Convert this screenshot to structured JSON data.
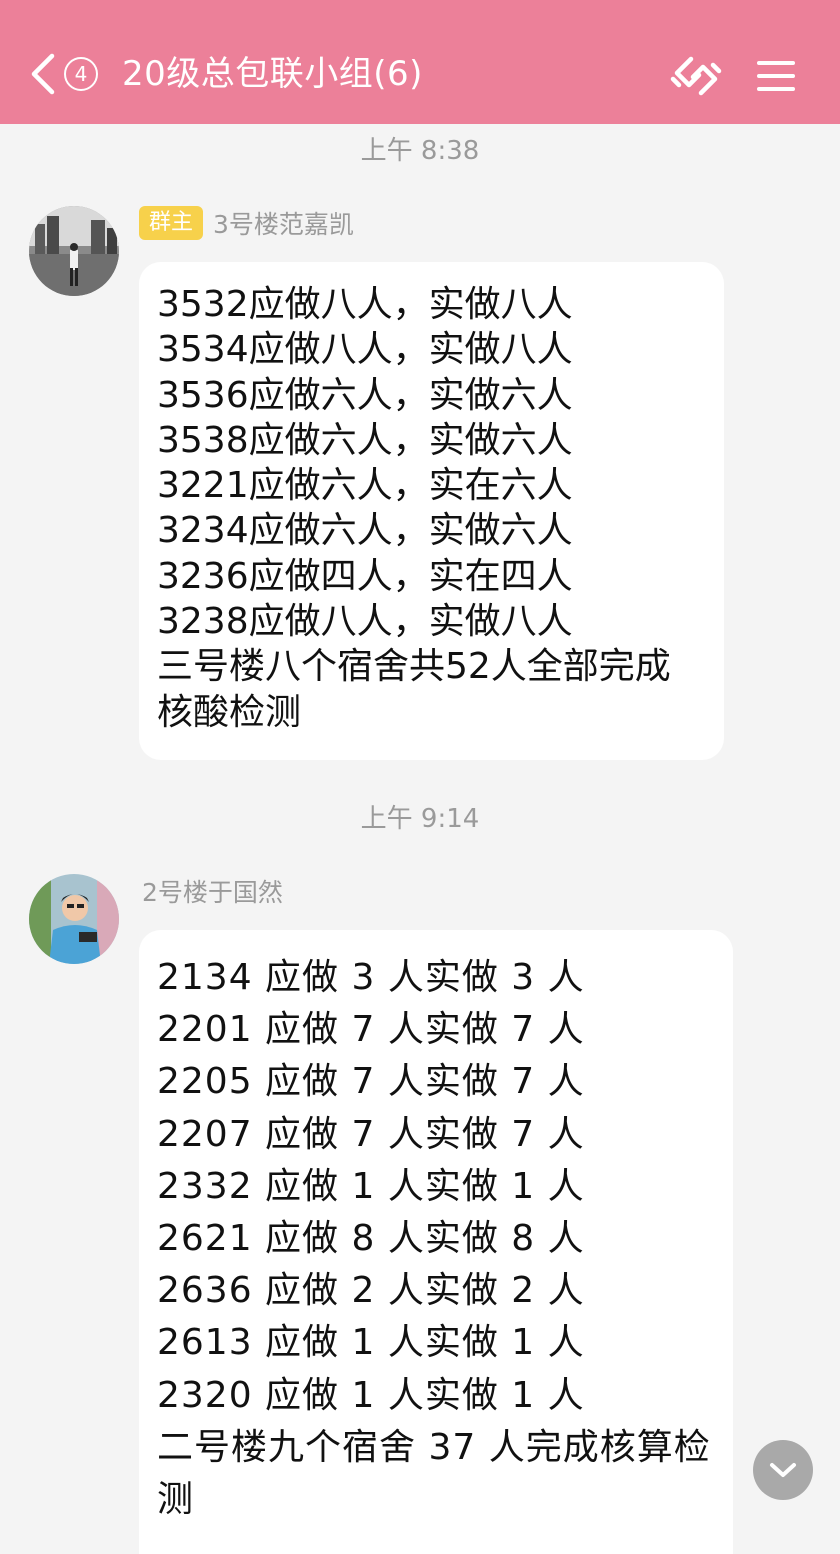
{
  "header": {
    "back_icon": "chevron-left-icon",
    "unread_count": "4",
    "title": "20级总包联小组(6)",
    "link_icon": "link-icon",
    "menu_icon": "hamburger-menu-icon",
    "bg_color": "#ec8099"
  },
  "messages": [
    {
      "time": "上午 8:38",
      "badge": "群主",
      "sender": "3号楼范嘉凯",
      "lines": [
        "3532应做八人，实做八人",
        "3534应做八人，实做八人",
        "3536应做六人，实做六人",
        "3538应做六人，实做六人",
        "3221应做六人，实在六人",
        "3234应做六人，实做六人",
        "3236应做四人，实在四人",
        "3238应做八人，实做八人",
        "三号楼八个宿舍共52人全部完成",
        "核酸检测"
      ]
    },
    {
      "time": "上午 9:14",
      "sender": "2号楼于国然",
      "lines": [
        "2134 应做 3 人实做 3 人",
        "2201 应做 7 人实做 7 人",
        "2205 应做 7 人实做 7 人",
        "2207 应做 7 人实做 7 人",
        "2332 应做 1 人实做 1 人",
        "2621 应做 8 人实做 8 人",
        "2636 应做 2 人实做 2 人",
        "2613 应做 1 人实做 1 人",
        "2320 应做 1 人实做 1 人",
        "二号楼九个宿舍 37 人完成核算检",
        "测"
      ]
    }
  ],
  "scroll_down_icon": "chevron-down-icon",
  "colors": {
    "owner_badge": "#f7d14b",
    "background": "#f4f4f4",
    "bubble": "#ffffff"
  }
}
